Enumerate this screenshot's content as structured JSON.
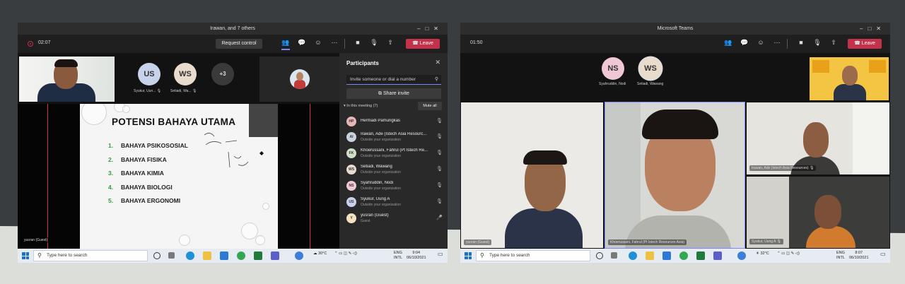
{
  "left_window": {
    "title": "Irawan, and 7 others",
    "timer": "02:07",
    "request_control": "Request control",
    "leave": "Leave",
    "more_count": "+3",
    "avatars": [
      {
        "initials": "US",
        "label": "Syukur, Uun...",
        "color": "#c7d3ea"
      },
      {
        "initials": "WS",
        "label": "Setiadi, Wa...",
        "color": "#e9dccc"
      }
    ],
    "presenter_label": "yusran (Guest)",
    "slide": {
      "title": "POTENSI BAHAYA UTAMA",
      "items": [
        {
          "num": "1.",
          "text": "BAHAYA PSIKOSOSIAL"
        },
        {
          "num": "2.",
          "text": "BAHAYA FISIKA"
        },
        {
          "num": "3.",
          "text": "BAHAYA KIMIA"
        },
        {
          "num": "4.",
          "text": "BAHAYA BIOLOGI"
        },
        {
          "num": "5.",
          "text": "BAHAYA ERGONOMI"
        }
      ]
    },
    "participants": {
      "title": "Participants",
      "invite_placeholder": "Invite someone or dial a number",
      "share_invite": "Share invite",
      "in_meeting": "In this meeting (7)",
      "mute_all": "Mute all",
      "people": [
        {
          "initials": "HP",
          "name": "Hermadi Pamungkas",
          "sub": "",
          "color": "#e8b6b6"
        },
        {
          "initials": "AI",
          "name": "Irawan, Ade (Istech Asia Resourc...",
          "sub": "Outside your organization",
          "color": "#c9d2df"
        },
        {
          "initials": "FK",
          "name": "Khoerussani, Fahrul (Pt Istech Re...",
          "sub": "Outside your organization",
          "color": "#cfe0c7"
        },
        {
          "initials": "WS",
          "name": "Setiadi, Wawang",
          "sub": "Outside your organization",
          "color": "#e9dccc"
        },
        {
          "initials": "NS",
          "name": "Syahruddin, Nodi",
          "sub": "Outside your organization",
          "color": "#f0c7d4"
        },
        {
          "initials": "US",
          "name": "Syukur, Uung A",
          "sub": "Outside your organization",
          "color": "#c7d3ea"
        },
        {
          "initials": "Y",
          "name": "yusran (Guest)",
          "sub": "Guest",
          "color": "#f2e2c0"
        }
      ]
    },
    "taskbar": {
      "search": "Type here to search",
      "weather": "30°C",
      "lang": "ENG\nINTL",
      "time": "9:04",
      "date": "06/10/2021"
    }
  },
  "right_window": {
    "title": "Microsoft Teams",
    "timer": "01:50",
    "leave": "Leave",
    "avatars": [
      {
        "initials": "NS",
        "label": "Syahruddin, Nodi",
        "color": "#f0c7d4"
      },
      {
        "initials": "WS",
        "label": "Setiadi, Wawang",
        "color": "#e9dccc"
      }
    ],
    "tiles": [
      {
        "label": "yusran (Guest)"
      },
      {
        "label": "Khoerussani, Fahrul (Pt Istech Resources Asia)"
      },
      {
        "label": "Irawan, Ade (Istech Asia Resources)"
      },
      {
        "label": "Syukur, Uung A"
      }
    ],
    "taskbar": {
      "search": "Type here to search",
      "weather": "32°C",
      "lang": "ENG\nINTL",
      "time": "8:07",
      "date": "06/10/2021"
    }
  }
}
